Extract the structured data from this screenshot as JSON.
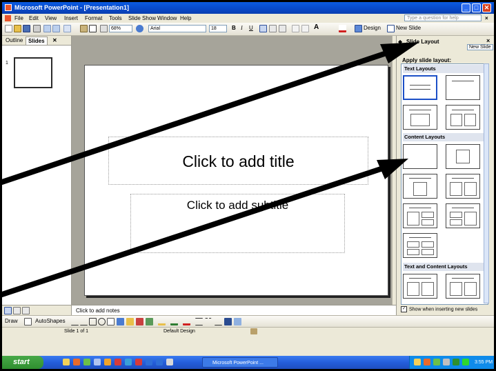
{
  "window": {
    "title": "Microsoft PowerPoint - [Presentation1]",
    "minimize_glyph": "_",
    "maximize_glyph": "□",
    "close_glyph": "✕"
  },
  "menubar": {
    "items": [
      "File",
      "Edit",
      "View",
      "Insert",
      "Format",
      "Tools",
      "Slide Show",
      "Window",
      "Help"
    ],
    "help_placeholder": "Type a question for help"
  },
  "toolbar": {
    "zoom": "68%",
    "font": "Arial",
    "font_size": "18",
    "bold": "B",
    "italic": "I",
    "underline": "U",
    "font_size_glyph": "A",
    "design_label": "Design",
    "new_slide_label": "New Slide"
  },
  "slides_pane": {
    "tabs": [
      "Outline",
      "Slides"
    ],
    "close_glyph": "✕",
    "slide_number": "1"
  },
  "slide": {
    "title_placeholder": "Click to add title",
    "subtitle_placeholder": "Click to add subtitle"
  },
  "notes": {
    "placeholder": "Click to add notes"
  },
  "task_pane": {
    "title": "Slide Layout",
    "apply_label": "Apply slide layout:",
    "new_slide_link": "New Slide",
    "sections": [
      "Text Layouts",
      "Content Layouts",
      "Text and Content Layouts"
    ],
    "show_when_inserting": "Show when inserting new slides",
    "show_when_checked": true
  },
  "drawing_toolbar": {
    "draw_label": "Draw",
    "autoshapes_label": "AutoShapes"
  },
  "status_bar": {
    "slide_info": "Slide 1 of 1",
    "design": "Default Design"
  },
  "taskbar": {
    "start_label": "start",
    "task_item": "Microsoft PowerPoint ...",
    "clock": "3:55 PM"
  },
  "colors": {
    "title_bar": "#0a5ae0",
    "chrome": "#ece9d8",
    "selection": "#1b4fc7",
    "annotation_arrow": "#000000"
  }
}
